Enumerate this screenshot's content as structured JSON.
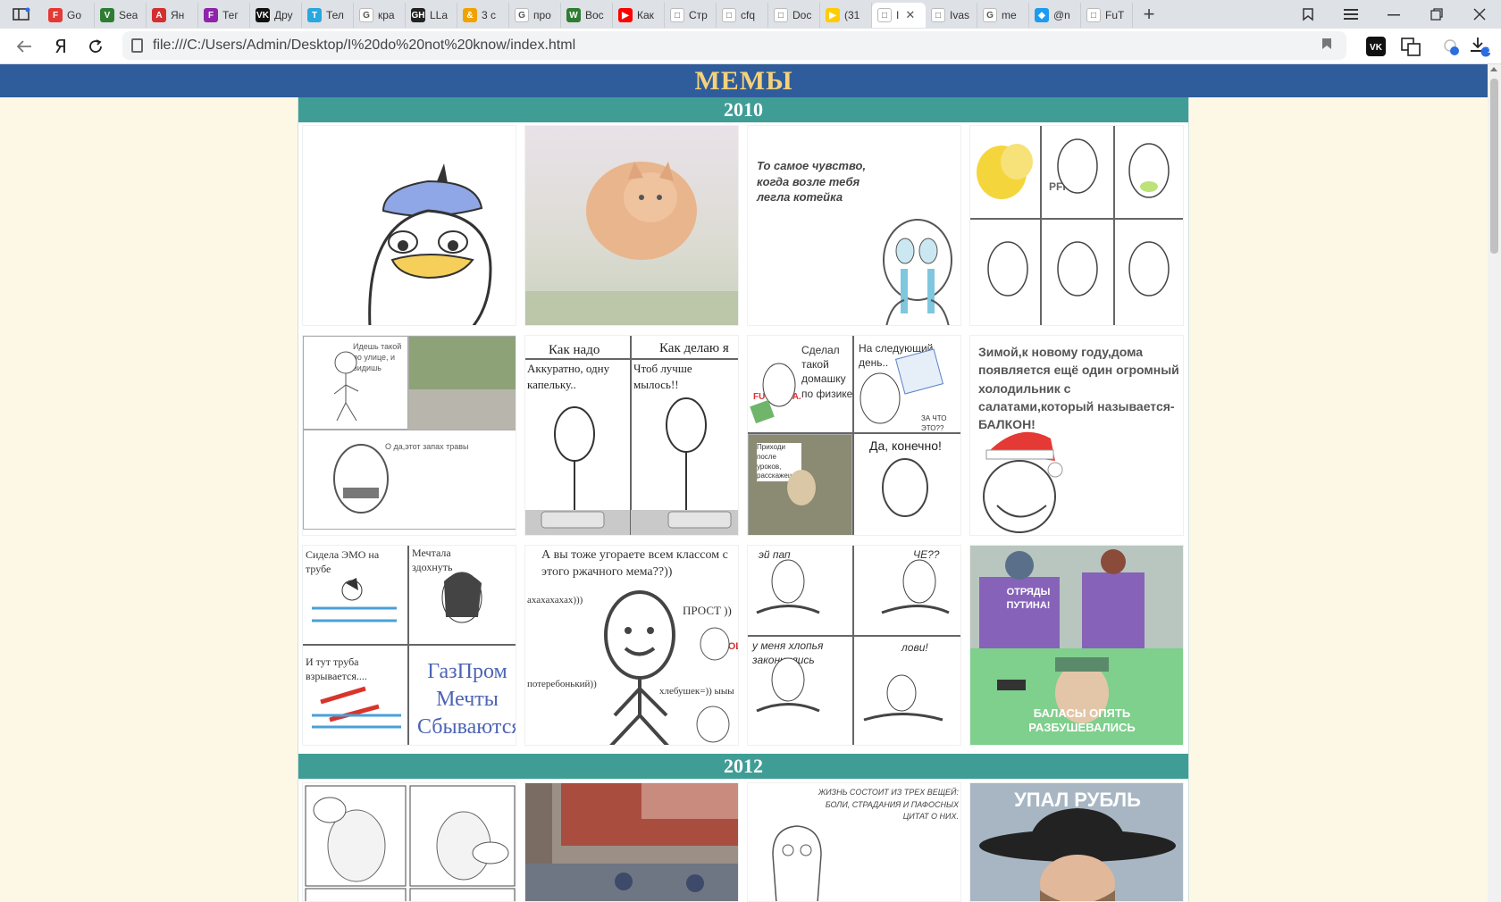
{
  "browser": {
    "tabs": [
      {
        "label": "Go",
        "color": "#e53935",
        "glyph": "F"
      },
      {
        "label": "Sea",
        "color": "#2e7d32",
        "glyph": "V"
      },
      {
        "label": "Ян",
        "color": "#d32f2f",
        "glyph": "A"
      },
      {
        "label": "Тег",
        "color": "#8e24aa",
        "glyph": "F"
      },
      {
        "label": "Дру",
        "color": "#111111",
        "glyph": "VK"
      },
      {
        "label": "Тел",
        "color": "#29a7df",
        "glyph": "T"
      },
      {
        "label": "кра",
        "color": "#ffffff",
        "glyph": "G"
      },
      {
        "label": "LLa",
        "color": "#222222",
        "glyph": "GH"
      },
      {
        "label": "3 с",
        "color": "#f0a300",
        "glyph": "&"
      },
      {
        "label": "про",
        "color": "#ffffff",
        "glyph": "G"
      },
      {
        "label": "Вос",
        "color": "#2e7d32",
        "glyph": "W"
      },
      {
        "label": "Как",
        "color": "#ff0000",
        "glyph": "▶"
      },
      {
        "label": "Стр",
        "color": "#ffffff",
        "glyph": "□"
      },
      {
        "label": "cfq",
        "color": "#ffffff",
        "glyph": "□"
      },
      {
        "label": "Doc",
        "color": "#ffffff",
        "glyph": "□"
      },
      {
        "label": "(31",
        "color": "#ffcc00",
        "glyph": "▶"
      },
      {
        "label": "I",
        "color": "#ffffff",
        "glyph": "□",
        "active": true
      },
      {
        "label": "Ivas",
        "color": "#ffffff",
        "glyph": "□"
      },
      {
        "label": "me",
        "color": "#ffffff",
        "glyph": "G"
      },
      {
        "label": "@n",
        "color": "#1d9bf0",
        "glyph": "◆"
      },
      {
        "label": "FuT",
        "color": "#ffffff",
        "glyph": "□"
      }
    ],
    "url": "file:///C:/Users/Admin/Desktop/I%20do%20not%20know/index.html",
    "download_badge": "1"
  },
  "page": {
    "title": "МЕМЫ",
    "sections": [
      {
        "year": "2010"
      },
      {
        "year": "2012"
      }
    ],
    "memes": {
      "kotejka": "То самое чувство, когда возле тебя легла котейка",
      "pff": "PFF",
      "idesh_1": "Идешь такой по улице, и видишь",
      "idesh_2": "О да,этот запах травы",
      "kak_nado": "Как надо",
      "kak_delayu": "Как делаю я",
      "akkuratno": "Аккуратно, одну капельку..",
      "chtob": "Чтоб лучше мылось!!",
      "sdelal": "Сделал такой домашку по физике",
      "fuck_yea": "FUCK YEA.",
      "na_sled": "На следующий день..",
      "za_chto": "ЗА ЧТО ЭТО??",
      "prihodi": "Приходи после уроков, расскажешь",
      "da_konechno": "Да, конечно!",
      "zimoy": "Зимой,к новому году,дома появляется ещё один огромный холодильник с салатами,который называется-БАЛКОН!",
      "sidela": "Сидела ЭМО на трубе",
      "mechtala": "Мечтала здохнуть",
      "truba": "И тут труба взрывается....",
      "gazprom_1": "ГазПром",
      "gazprom_2": "Мечты",
      "gazprom_3": "Сбываются",
      "ugoraete": "А вы тоже угораете всем классом с этого ржачного мема??))",
      "ahaha": "ахахахахах)))",
      "prost": "ПРОСТ ))",
      "lol": "LOL",
      "poterebonky": "потеребонький))",
      "hlebushek": "хлебушек=)) ыыы",
      "ey_pap": "эй пап",
      "che": "ЧЕ??",
      "u_menya": "у меня хлопья закончились",
      "lovi": "лови!",
      "otryady": "ОТРЯДЫ ПУТИНА!",
      "balasy": "БАЛАСЫ ОПЯТЬ РАЗБУШЕВАЛИСЬ",
      "zhizn": "ЖИЗНЬ СОСТОИТ ИЗ ТРЕХ ВЕЩЕЙ: БОЛИ, СТРАДАНИЯ И ПАФОСНЫХ ЦИТАТ О НИХ.",
      "upal_rubl": "УПАЛ РУБЛЬ"
    }
  }
}
